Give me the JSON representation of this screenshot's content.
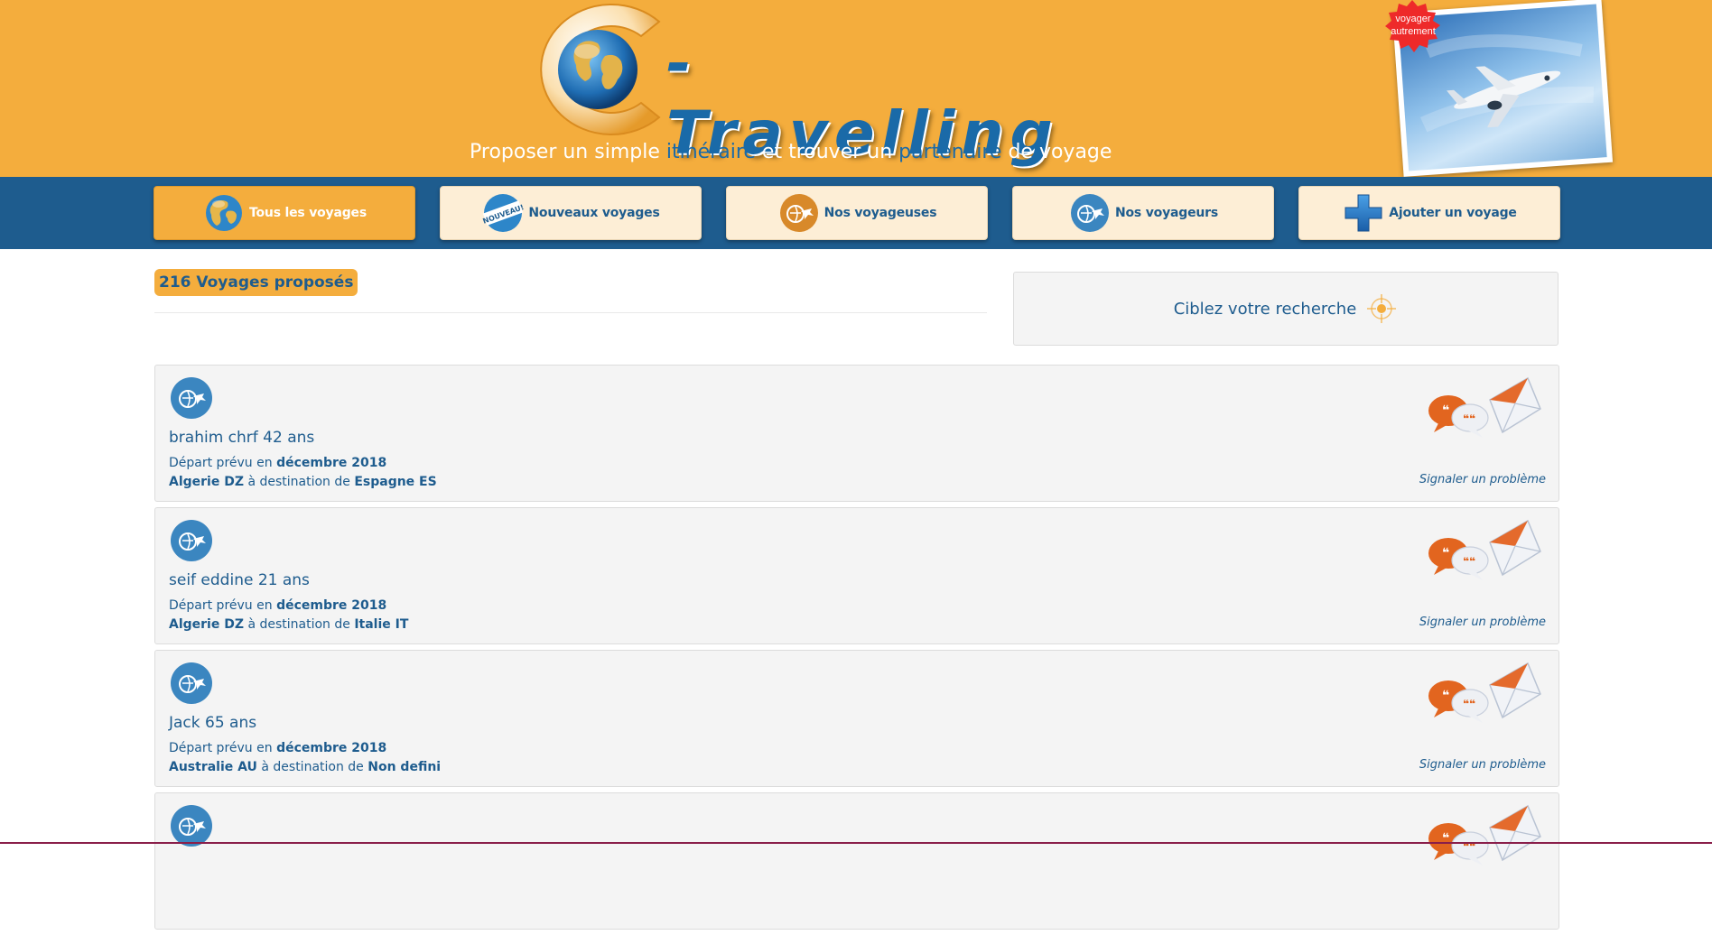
{
  "header": {
    "logo_text": "-Travelling",
    "badge_text": "voyager autrement",
    "tagline": {
      "part1": "Proposer un simple ",
      "highlight1": "itinéraire",
      "part2": " et trouver un ",
      "highlight2": "partenaire",
      "part3": " de voyage"
    }
  },
  "nav": {
    "items": [
      {
        "label": "Tous les voyages",
        "icon": "globe-icon",
        "active": true
      },
      {
        "label": "Nouveaux voyages",
        "icon": "nouveau-icon",
        "active": false
      },
      {
        "label": "Nos voyageuses",
        "icon": "female-traveler-icon",
        "active": false
      },
      {
        "label": "Nos voyageurs",
        "icon": "male-traveler-icon",
        "active": false
      },
      {
        "label": "Ajouter un voyage",
        "icon": "plus-icon",
        "active": false
      }
    ]
  },
  "results": {
    "count_label": "216 Voyages proposés"
  },
  "search": {
    "label": "Ciblez votre recherche",
    "icon": "target-icon"
  },
  "trips": [
    {
      "name": "brahim chrf 42 ans",
      "depart_prefix": "Départ prévu en ",
      "date": "décembre 2018",
      "origin": "Algerie DZ",
      "dest_word": " à destination de ",
      "destination": "Espagne ES",
      "report": "Signaler un problème"
    },
    {
      "name": "seif eddine 21 ans",
      "depart_prefix": "Départ prévu en ",
      "date": "décembre 2018",
      "origin": "Algerie DZ",
      "dest_word": " à destination de ",
      "destination": "Italie IT",
      "report": "Signaler un problème"
    },
    {
      "name": "Jack 65 ans",
      "depart_prefix": "Départ prévu en ",
      "date": "décembre 2018",
      "origin": "Australie AU",
      "dest_word": " à destination de ",
      "destination": "Non defini",
      "report": "Signaler un problème"
    },
    {
      "name": "",
      "depart_prefix": "",
      "date": "",
      "origin": "",
      "dest_word": "",
      "destination": "",
      "report": ""
    }
  ],
  "colors": {
    "header_orange": "#f4ad3d",
    "nav_blue": "#1e5c8e",
    "text_blue": "#1e5c8e",
    "card_bg": "#f4f4f4"
  }
}
